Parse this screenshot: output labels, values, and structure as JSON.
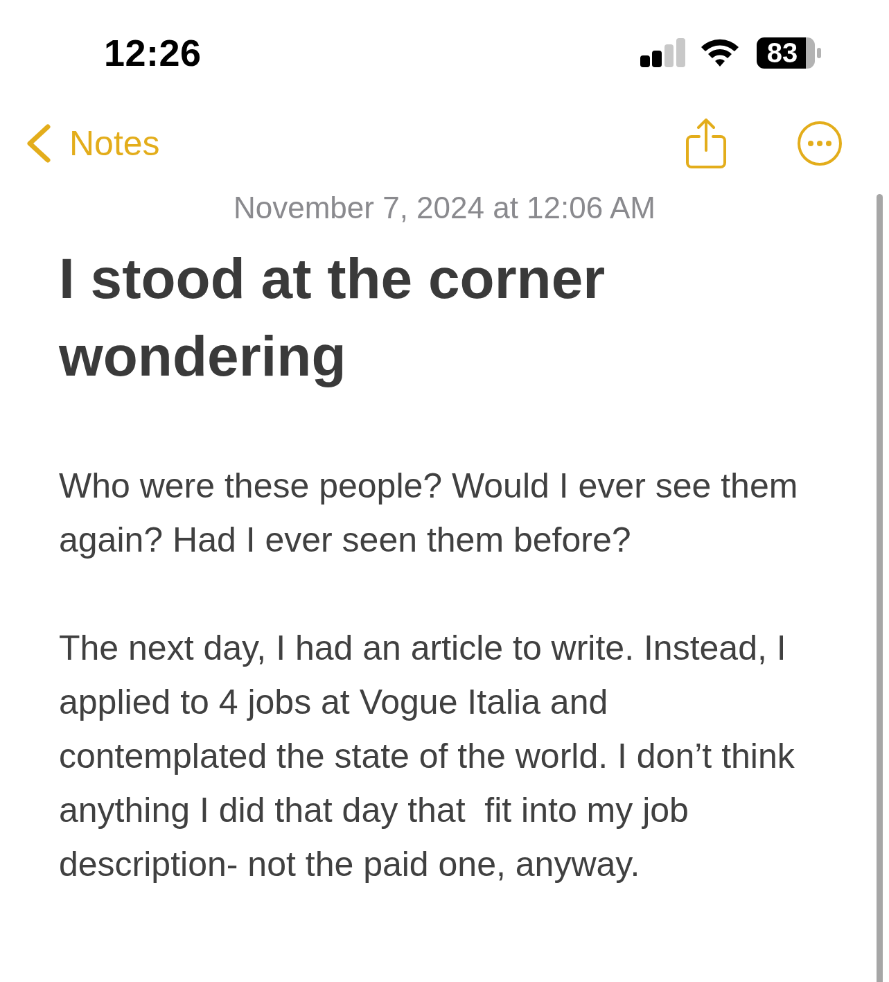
{
  "status_bar": {
    "time": "12:26",
    "battery": "83"
  },
  "nav": {
    "back_label": "Notes"
  },
  "note": {
    "date": "November 7, 2024 at 12:06 AM",
    "title": "I stood at the corner wondering",
    "paragraphs": [
      "Who were these people? Would I ever see them again? Had I ever seen them before?",
      "The next day, I had an article to write. Instead, I applied to 4 jobs at Vogue Italia and contemplated the state of the world. I don’t think anything I did that day that  fit into my job description- not the paid one, anyway."
    ]
  }
}
